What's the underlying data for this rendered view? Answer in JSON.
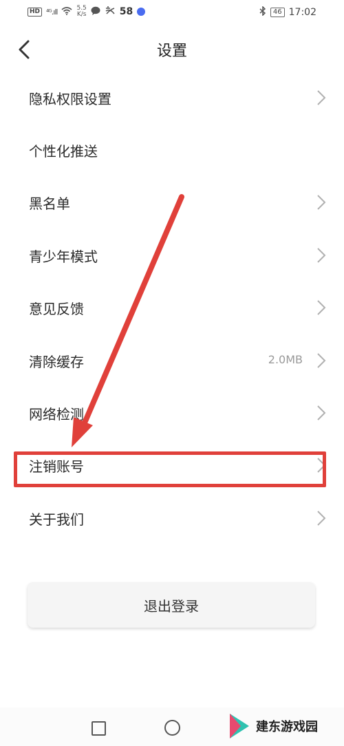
{
  "status_bar": {
    "hd": "HD",
    "signal": "⁴ᴳ.ıll",
    "speed_top": "5.5",
    "speed_bottom": "K/s",
    "notif_count": "58",
    "battery": "46",
    "time": "17:02"
  },
  "header": {
    "title": "设置"
  },
  "settings": {
    "items": [
      {
        "label": "隐私权限设置",
        "value": "",
        "chevron": true
      },
      {
        "label": "个性化推送",
        "value": "",
        "chevron": false
      },
      {
        "label": "黑名单",
        "value": "",
        "chevron": true
      },
      {
        "label": "青少年模式",
        "value": "",
        "chevron": true
      },
      {
        "label": "意见反馈",
        "value": "",
        "chevron": true
      },
      {
        "label": "清除缓存",
        "value": "2.0MB",
        "chevron": true
      },
      {
        "label": "网络检测",
        "value": "",
        "chevron": true
      },
      {
        "label": "注销账号",
        "value": "",
        "chevron": true
      },
      {
        "label": "关于我们",
        "value": "",
        "chevron": true
      }
    ]
  },
  "logout": {
    "label": "退出登录"
  },
  "watermark": {
    "text": "建东游戏园"
  },
  "colors": {
    "highlight": "#e0403a",
    "chevron": "#b0b0b0",
    "accent_blue": "#4a6cf0"
  }
}
